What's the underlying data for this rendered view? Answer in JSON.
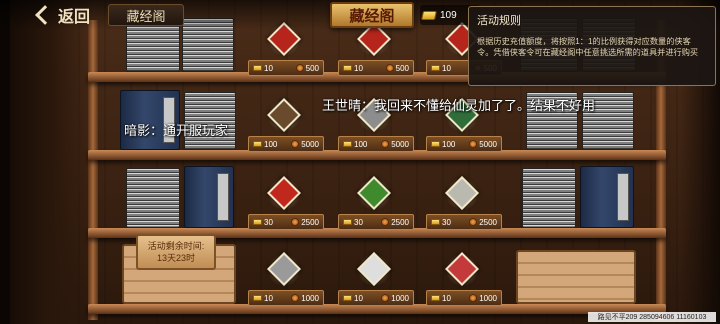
{
  "topbar": {
    "back_label": "返回",
    "tab_label": "藏经阁",
    "title": "藏经阁",
    "currency_value": "109"
  },
  "rules": {
    "title": "活动规则",
    "text": "根据历史充值额度，将按照1：1的比例获得对应数量的侠客令。凭借侠客令可在藏经阁中任意挑选所需的道具并进行购买"
  },
  "chat": {
    "line1": "王世晴：我回来不懂给仙灵加了了。结果不好用",
    "line2": "暗影：通开服玩家"
  },
  "timer": {
    "line1": "活动剩余时间:",
    "line2": "13天23时"
  },
  "items": [
    {
      "gold": "10",
      "token": "500",
      "icon": "red-gift-box-icon",
      "color": "#b5251c"
    },
    {
      "gold": "10",
      "token": "500",
      "icon": "red-gift-box-icon",
      "color": "#b5251c"
    },
    {
      "gold": "10",
      "token": "500",
      "icon": "red-gift-box-icon",
      "color": "#b5251c"
    },
    {
      "gold": "100",
      "token": "5000",
      "icon": "scroll-portrait-icon",
      "color": "#6a4a2c"
    },
    {
      "gold": "100",
      "token": "5000",
      "icon": "silver-chest-icon",
      "color": "#8d8d8d"
    },
    {
      "gold": "100",
      "token": "5000",
      "icon": "green-chest-icon",
      "color": "#2f6d3a"
    },
    {
      "gold": "30",
      "token": "2500",
      "icon": "red-gem-box-icon",
      "color": "#c0281e"
    },
    {
      "gold": "30",
      "token": "2500",
      "icon": "green-gem-box-icon",
      "color": "#3f8a2c"
    },
    {
      "gold": "30",
      "token": "2500",
      "icon": "silver-ore-icon",
      "color": "#b9b9b0"
    },
    {
      "gold": "10",
      "token": "1000",
      "icon": "silver-shard-icon",
      "color": "#9a9a9a"
    },
    {
      "gold": "10",
      "token": "1000",
      "icon": "white-crystal-icon",
      "color": "#dedede"
    },
    {
      "gold": "10",
      "token": "1000",
      "icon": "red-silver-crystal-icon",
      "color": "#c43a3a"
    }
  ],
  "footer": {
    "text": "路见不平209 285094606 11160103"
  }
}
